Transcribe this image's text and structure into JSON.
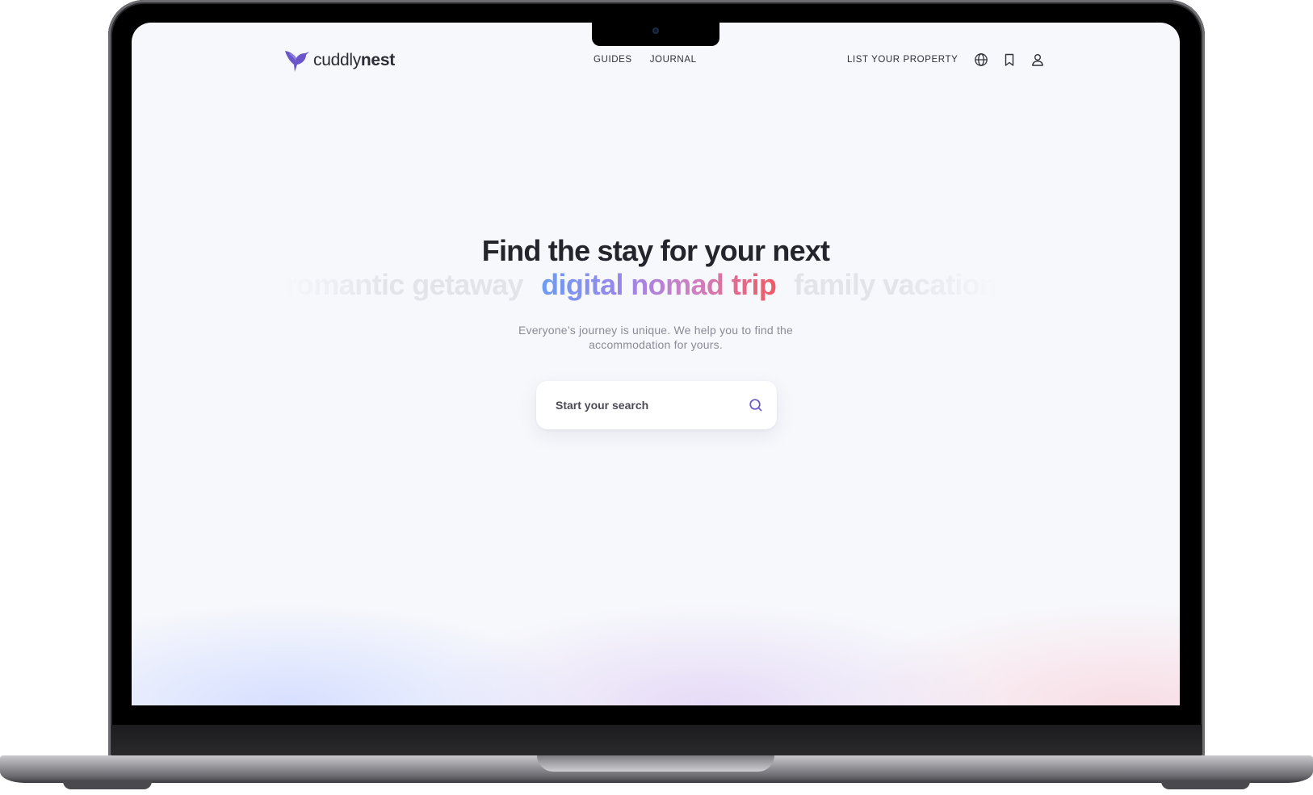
{
  "brand": {
    "logo_light": "cuddly",
    "logo_bold": "nest",
    "accent": "#6a56c9"
  },
  "nav": {
    "center": [
      {
        "label": "GUIDES"
      },
      {
        "label": "JOURNAL"
      }
    ],
    "list_property": "LIST YOUR PROPERTY",
    "icons": [
      "globe-icon",
      "bookmark-icon",
      "user-icon"
    ]
  },
  "hero": {
    "title": "Find the stay for your next",
    "rotating_words": [
      "romantic getaway",
      "digital nomad trip",
      "family vacation"
    ],
    "active_index": 1,
    "subtitle_line1": "Everyone’s journey is unique. We help you to find the",
    "subtitle_line2": "accommodation for yours."
  },
  "search": {
    "placeholder": "Start your search",
    "icon": "search-icon"
  }
}
